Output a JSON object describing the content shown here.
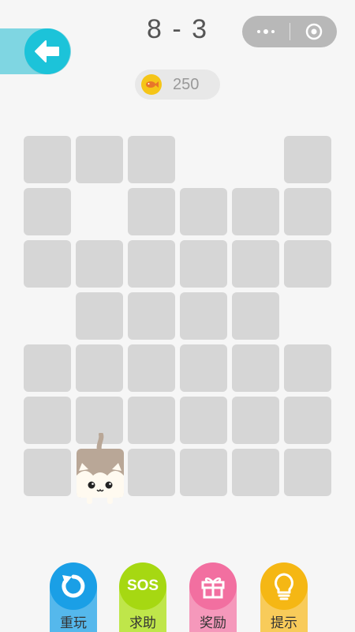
{
  "level": {
    "title": "8 - 3"
  },
  "coins": {
    "count": "250"
  },
  "colors": {
    "tile": "#d6d6d6",
    "back_circle": "#1cc3d9",
    "back_tab": "#7fd6e2",
    "coin": "#f5c518",
    "replay": "#1a9fe6",
    "sos": "#a6d812",
    "reward": "#f26fa0",
    "hint": "#f5b714"
  },
  "board": {
    "rows": [
      [
        1,
        1,
        1,
        0,
        0,
        1
      ],
      [
        1,
        0,
        1,
        1,
        1,
        1
      ],
      [
        1,
        1,
        1,
        1,
        1,
        1
      ],
      [
        0,
        1,
        1,
        1,
        1,
        0
      ],
      [
        1,
        1,
        1,
        1,
        1,
        1
      ],
      [
        1,
        1,
        1,
        1,
        1,
        1
      ],
      [
        1,
        1,
        1,
        1,
        1,
        1
      ]
    ],
    "player": {
      "row": 6,
      "col": 1
    }
  },
  "buttons": {
    "replay": {
      "label": "重玩",
      "icon": "replay-icon"
    },
    "sos": {
      "label": "求助",
      "icon_text": "SOS"
    },
    "reward": {
      "label": "奖励",
      "icon": "gift-icon"
    },
    "hint": {
      "label": "提示",
      "icon": "lightbulb-icon"
    }
  }
}
